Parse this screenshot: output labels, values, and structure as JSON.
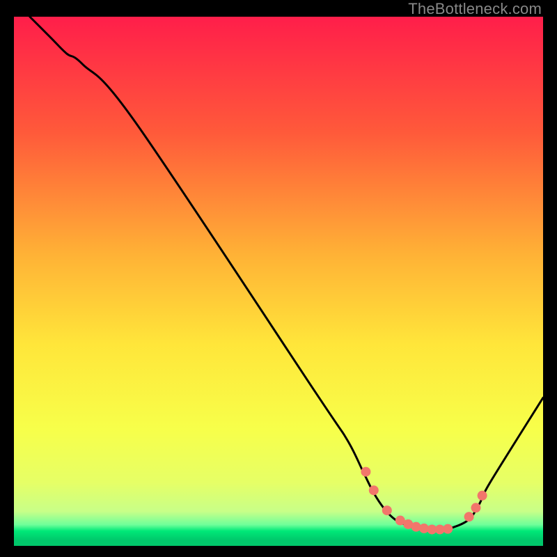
{
  "attribution": "TheBottleneck.com",
  "chart_data": {
    "type": "line",
    "title": "",
    "xlabel": "",
    "ylabel": "",
    "xlim": [
      0,
      100
    ],
    "ylim": [
      0,
      100
    ],
    "gradient_stops": [
      {
        "offset": 0,
        "color": "#ff1e4a"
      },
      {
        "offset": 22,
        "color": "#ff5a3a"
      },
      {
        "offset": 45,
        "color": "#ffb236"
      },
      {
        "offset": 62,
        "color": "#ffe63a"
      },
      {
        "offset": 78,
        "color": "#f7ff4a"
      },
      {
        "offset": 88,
        "color": "#e6ff66"
      },
      {
        "offset": 93.5,
        "color": "#c8ff88"
      },
      {
        "offset": 96,
        "color": "#6fff9a"
      },
      {
        "offset": 97.2,
        "color": "#00e878"
      },
      {
        "offset": 99,
        "color": "#00c76a"
      }
    ],
    "series": [
      {
        "name": "bottleneck-curve",
        "x": [
          3,
          7,
          10,
          13,
          23,
          57,
          63,
          66,
          68,
          70,
          72,
          74,
          76,
          78,
          80,
          83,
          86,
          88,
          90,
          100
        ],
        "y": [
          100,
          96,
          93,
          91,
          80,
          29,
          20,
          14,
          10,
          7,
          5,
          4,
          3.3,
          3,
          3,
          3.5,
          5,
          8,
          12,
          28
        ]
      }
    ],
    "markers": {
      "name": "highlight-dots",
      "x": [
        66.5,
        68,
        70.5,
        73,
        74.5,
        76,
        77.5,
        79,
        80.5,
        82,
        86,
        87.3,
        88.5
      ],
      "y": [
        14,
        10.5,
        6.7,
        4.8,
        4.1,
        3.6,
        3.3,
        3.1,
        3.1,
        3.2,
        5.5,
        7.2,
        9.5
      ],
      "color": "#f2766b",
      "radius": 7
    }
  }
}
